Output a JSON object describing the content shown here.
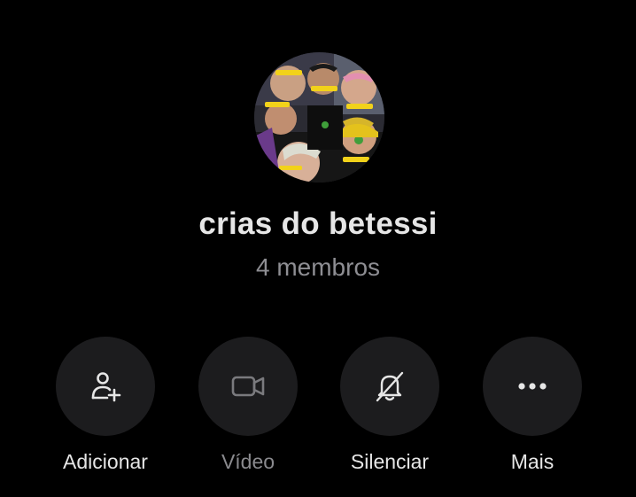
{
  "group": {
    "name": "crias do betessi",
    "members": "4 membros",
    "avatar": "group-photo"
  },
  "actions": [
    {
      "label": "Adicionar",
      "icon": "add-person-icon",
      "enabled": true
    },
    {
      "label": "Vídeo",
      "icon": "video-camera-icon",
      "enabled": false
    },
    {
      "label": "Silenciar",
      "icon": "bell-off-icon",
      "enabled": true
    },
    {
      "label": "Mais",
      "icon": "more-dots-icon",
      "enabled": true
    }
  ],
  "colors": {
    "background": "#000000",
    "button": "#1c1c1e",
    "text": "#e6e6e6",
    "muted": "#8e8e93"
  }
}
